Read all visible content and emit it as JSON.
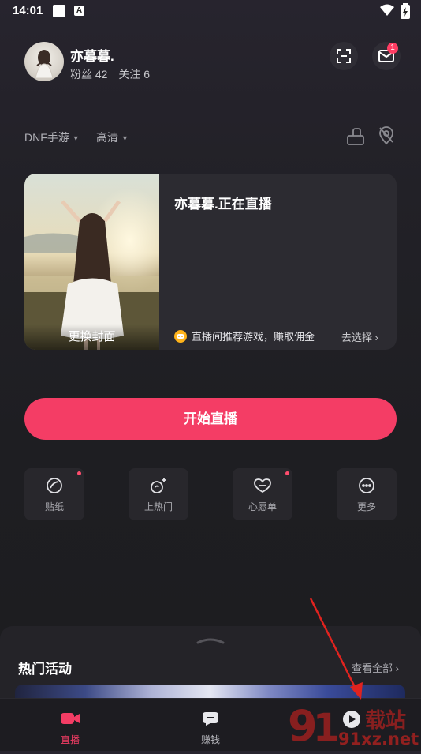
{
  "status_bar": {
    "time": "14:01",
    "app_badge": "A"
  },
  "profile": {
    "name": "亦暮暮.",
    "fans": "粉丝 42",
    "following": "关注 6",
    "mail_badge_count": "1"
  },
  "selectors": {
    "game": "DNF手游",
    "quality": "高清"
  },
  "live_card": {
    "cover_label": "更换封面",
    "title": "亦暮暮.正在直播",
    "promo_text": "直播间推荐游戏，赚取佣金",
    "promo_link": "去选择 ›"
  },
  "start_button": "开始直播",
  "tools": [
    {
      "label": "贴纸",
      "icon": "sticker-icon",
      "has_dot": true
    },
    {
      "label": "上热门",
      "icon": "trending-icon",
      "has_dot": false
    },
    {
      "label": "心愿单",
      "icon": "wishlist-icon",
      "has_dot": true
    },
    {
      "label": "更多",
      "icon": "more-icon",
      "has_dot": false
    }
  ],
  "hot_activities": {
    "title": "热门活动",
    "view_all": "查看全部 ›"
  },
  "tabbar": [
    {
      "label": "直播",
      "icon": "live-camera-icon",
      "active": true
    },
    {
      "label": "赚钱",
      "icon": "earn-money-icon",
      "active": false
    }
  ],
  "watermark": "91xz.net",
  "watermark_cn": "载站",
  "colors": {
    "accent": "#f43d65",
    "background": "#1e1e22",
    "card": "#2c2b31"
  }
}
